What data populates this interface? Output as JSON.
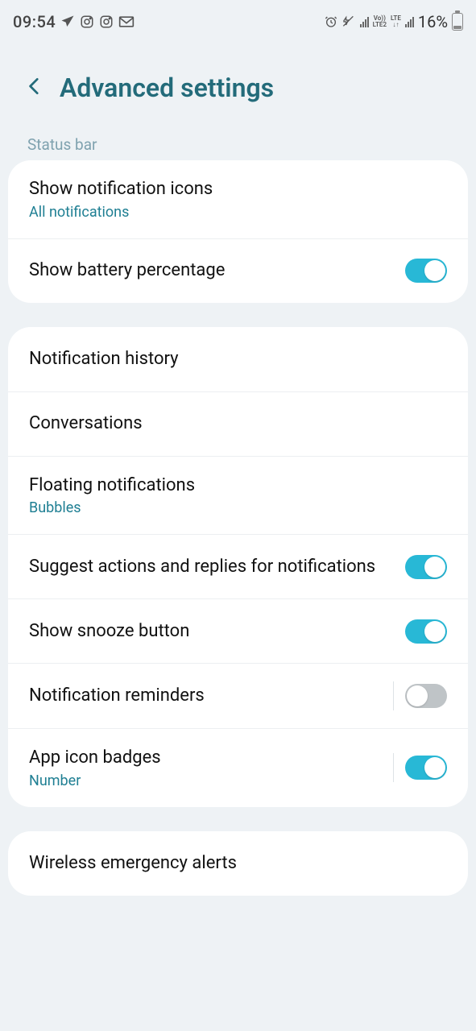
{
  "status": {
    "time": "09:54",
    "battery_pct": "16%"
  },
  "header": {
    "title": "Advanced settings"
  },
  "section1_label": "Status bar",
  "card1": {
    "row0": {
      "title": "Show notification icons",
      "sub": "All notifications"
    },
    "row1": {
      "title": "Show battery percentage",
      "toggle": true
    }
  },
  "card2": {
    "row0": {
      "title": "Notification history"
    },
    "row1": {
      "title": "Conversations"
    },
    "row2": {
      "title": "Floating notifications",
      "sub": "Bubbles"
    },
    "row3": {
      "title": "Suggest actions and replies for notifications",
      "toggle": true
    },
    "row4": {
      "title": "Show snooze button",
      "toggle": true
    },
    "row5": {
      "title": "Notification reminders",
      "toggle": false
    },
    "row6": {
      "title": "App icon badges",
      "sub": "Number",
      "toggle": true
    }
  },
  "card3": {
    "row0": {
      "title": "Wireless emergency alerts"
    }
  }
}
